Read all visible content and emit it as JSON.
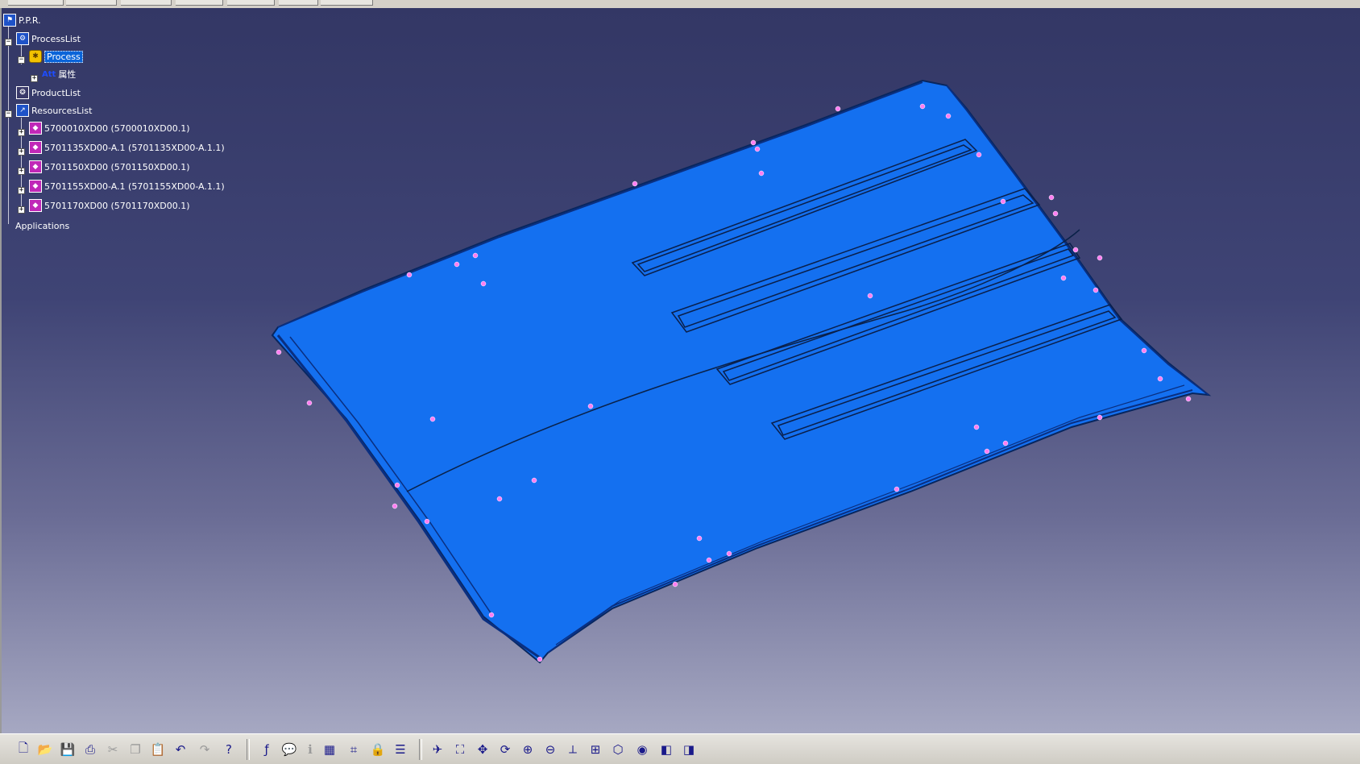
{
  "tree": {
    "root": "P.P.R.",
    "process_list": "ProcessList",
    "process": "Process",
    "attributes_badge": "Att",
    "attributes": "属性",
    "product_list": "ProductList",
    "resources_list": "ResourcesList",
    "resources": [
      "5700010XD00 (5700010XD00.1)",
      "5701135XD00-A.1 (5701135XD00-A.1.1)",
      "5701150XD00 (5701150XD00.1)",
      "5701155XD00-A.1 (5701155XD00-A.1.1)",
      "5701170XD00 (5701170XD00.1)"
    ],
    "applications": "Applications"
  },
  "colors": {
    "background_top": "#333765",
    "background_bottom": "#a6a8c2",
    "part_fill": "#1470f0",
    "selection": "#0a64d8",
    "marker": "#ff7ef2"
  },
  "toolbar": {
    "icons": [
      "new-icon",
      "open-icon",
      "save-icon",
      "print-icon",
      "cut-icon",
      "copy-icon",
      "paste-icon",
      "undo-icon",
      "redo-icon",
      "whats-this-icon",
      "formula-icon",
      "comment-icon",
      "info-icon",
      "catalog-icon",
      "tree-icon",
      "lock-icon",
      "properties-icon",
      "fly-mode-icon",
      "fit-all-icon",
      "pan-icon",
      "rotate-icon",
      "zoom-in-icon",
      "zoom-out-icon",
      "normal-view-icon",
      "multi-view-icon",
      "iso-view-icon",
      "shading-icon",
      "hide-show-icon",
      "swap-visible-icon"
    ]
  }
}
